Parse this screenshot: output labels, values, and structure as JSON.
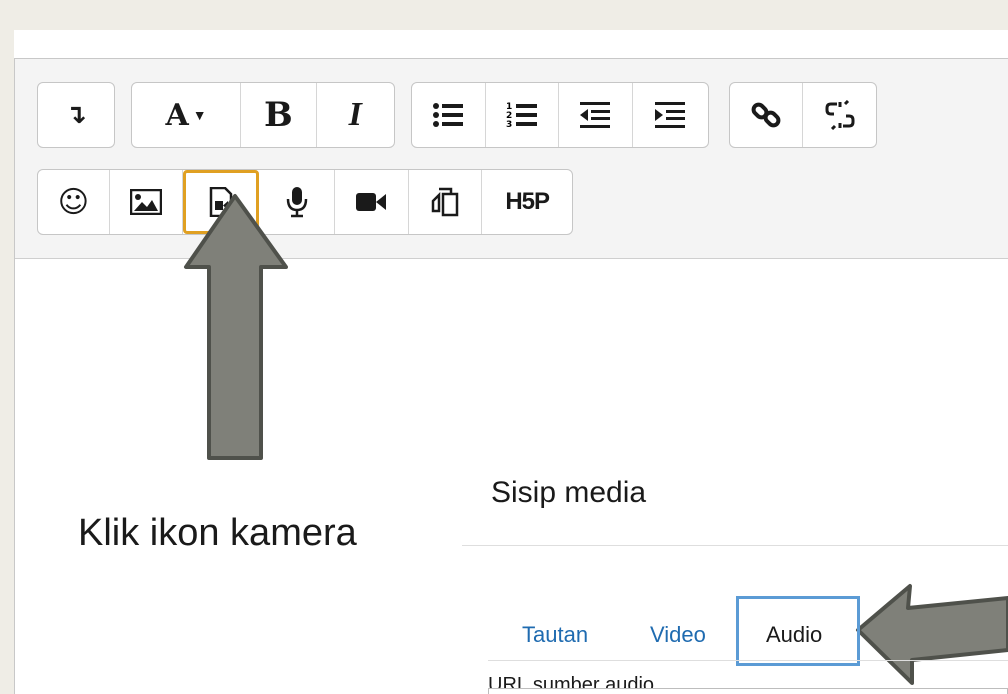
{
  "toolbar": {
    "row1": [
      {
        "name": "show-more-buttons",
        "glyph": "↴",
        "label": ""
      },
      {
        "name": "font-style",
        "glyph": "A▾"
      },
      {
        "name": "bold",
        "glyph": "B"
      },
      {
        "name": "italic",
        "glyph": "I"
      },
      {
        "name": "unordered-list",
        "glyph": ""
      },
      {
        "name": "ordered-list",
        "glyph": ""
      },
      {
        "name": "outdent",
        "glyph": ""
      },
      {
        "name": "indent",
        "glyph": ""
      },
      {
        "name": "link",
        "glyph": ""
      },
      {
        "name": "unlink",
        "glyph": ""
      }
    ],
    "row2": [
      {
        "name": "emoticon",
        "glyph": "☺"
      },
      {
        "name": "insert-image",
        "glyph": ""
      },
      {
        "name": "insert-media",
        "glyph": ""
      },
      {
        "name": "record-audio",
        "glyph": ""
      },
      {
        "name": "record-video",
        "glyph": ""
      },
      {
        "name": "manage-files",
        "glyph": ""
      },
      {
        "name": "insert-h5p",
        "glyph": "H5P"
      }
    ],
    "active_button": "insert-media",
    "highlight_color": "#e0a022"
  },
  "annotation": {
    "caption": "Klik ikon kamera",
    "arrow_color": "#7f8079"
  },
  "dialog": {
    "title": "Sisip media",
    "tabs": [
      "Tautan",
      "Video",
      "Audio"
    ],
    "active_tab": "Audio",
    "tab_highlight_color": "#5b9bd5",
    "field_label": "URL sumber audio",
    "field_value": ""
  }
}
